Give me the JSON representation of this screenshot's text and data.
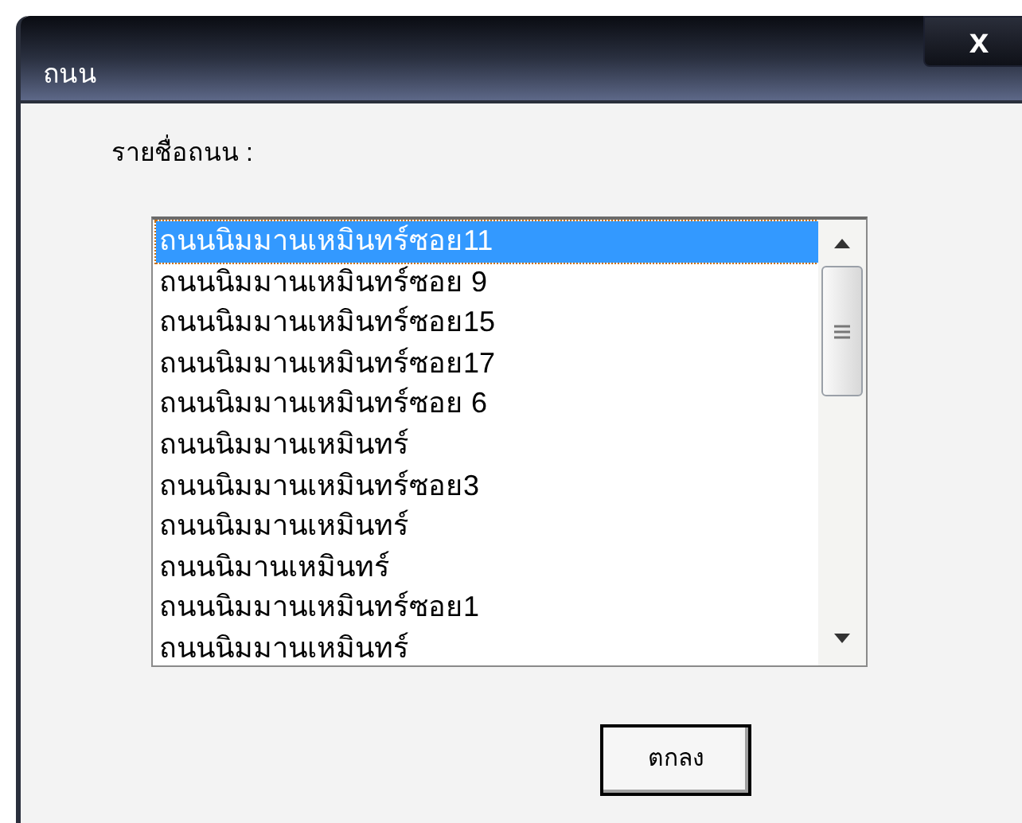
{
  "window": {
    "title": "ถนน",
    "close_label": "x"
  },
  "list_label": "รายชื่อถนน :",
  "list": {
    "items": [
      {
        "label": "ถนนนิมมานเหมินทร์ซอย11",
        "selected": true
      },
      {
        "label": "ถนนนิมมานเหมินทร์ซอย 9",
        "selected": false
      },
      {
        "label": "ถนนนิมมานเหมินทร์ซอย15",
        "selected": false
      },
      {
        "label": "ถนนนิมมานเหมินทร์ซอย17",
        "selected": false
      },
      {
        "label": "ถนนนิมมานเหมินทร์ซอย 6",
        "selected": false
      },
      {
        "label": "ถนนนิมมานเหมินทร์",
        "selected": false
      },
      {
        "label": "ถนนนิมมานเหมินทร์ซอย3",
        "selected": false
      },
      {
        "label": "ถนนนิมมานเหมินทร์",
        "selected": false
      },
      {
        "label": "ถนนนิมานเหมินทร์",
        "selected": false
      },
      {
        "label": "ถนนนิมมานเหมินทร์ซอย1",
        "selected": false
      },
      {
        "label": "ถนนนิมมานเหมินทร์",
        "selected": false
      }
    ]
  },
  "buttons": [
    "ตกลง"
  ]
}
